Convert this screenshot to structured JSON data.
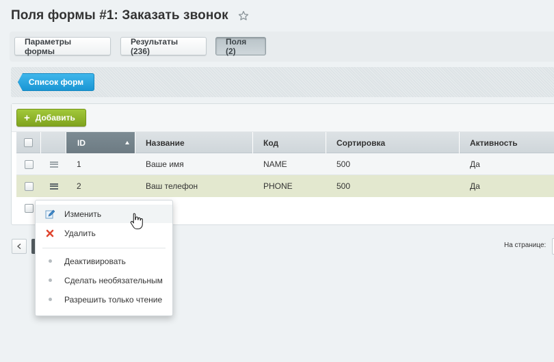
{
  "header": {
    "title": "Поля формы #1: Заказать звонок",
    "favorite_icon": "star-icon"
  },
  "tabs": [
    {
      "label": "Параметры формы",
      "active": false
    },
    {
      "label": "Результаты (236)",
      "active": false
    },
    {
      "label": "Поля (2)",
      "active": true
    }
  ],
  "context_bar": {
    "forms_list_label": "Список форм",
    "accent": "#1a96d4"
  },
  "toolbar": {
    "add_label": "Добавить",
    "add_icon": "plus-icon",
    "accent": "#8ab02a"
  },
  "grid": {
    "columns": [
      "ID",
      "Название",
      "Код",
      "Сортировка",
      "Активность"
    ],
    "sort_column": "ID",
    "rows": [
      {
        "id": "1",
        "name": "Ваше имя",
        "code": "NAME",
        "sort": "500",
        "active": "Да"
      },
      {
        "id": "2",
        "name": "Ваш телефон",
        "code": "PHONE",
        "sort": "500",
        "active": "Да"
      }
    ]
  },
  "pager": {
    "per_page_label": "На странице:"
  },
  "context_menu": {
    "items": [
      {
        "label": "Изменить",
        "icon": "edit-icon"
      },
      {
        "label": "Удалить",
        "icon": "delete-icon"
      },
      {
        "label": "Деактивировать",
        "icon": "dot-icon"
      },
      {
        "label": "Сделать необязательным",
        "icon": "dot-icon"
      },
      {
        "label": "Разрешить только чтение",
        "icon": "dot-icon"
      }
    ]
  }
}
